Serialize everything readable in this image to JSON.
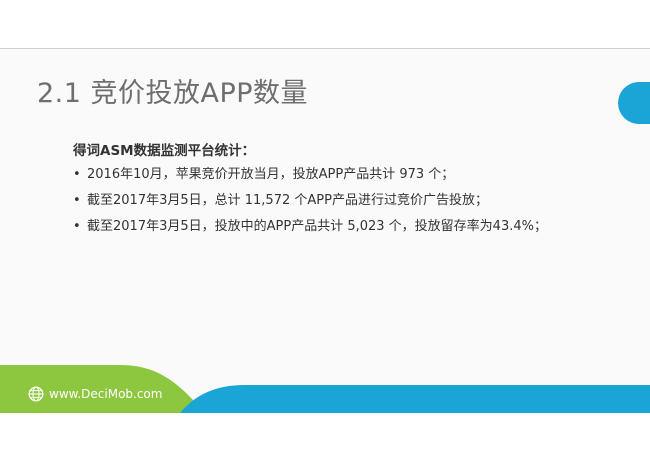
{
  "slide": {
    "title": "2.1 竞价投放APP数量",
    "subtitle": "得词ASM数据监测平台统计：",
    "bullets": [
      "2016年10月，苹果竞价开放当月，投放APP产品共计 973 个；",
      "截至2017年3月5日，总计 11,572 个APP产品进行过竞价广告投放；",
      "截至2017年3月5日，投放中的APP产品共计 5,023 个，投放留存率为43.4%；"
    ],
    "bullet_marker": "•"
  },
  "footer": {
    "url": "www.DeciMob.com",
    "icon": "globe-icon"
  },
  "colors": {
    "title": "#6e6e6e",
    "text": "#333333",
    "accent_blue": "#1aa5d6",
    "accent_green": "#8dc63f"
  }
}
